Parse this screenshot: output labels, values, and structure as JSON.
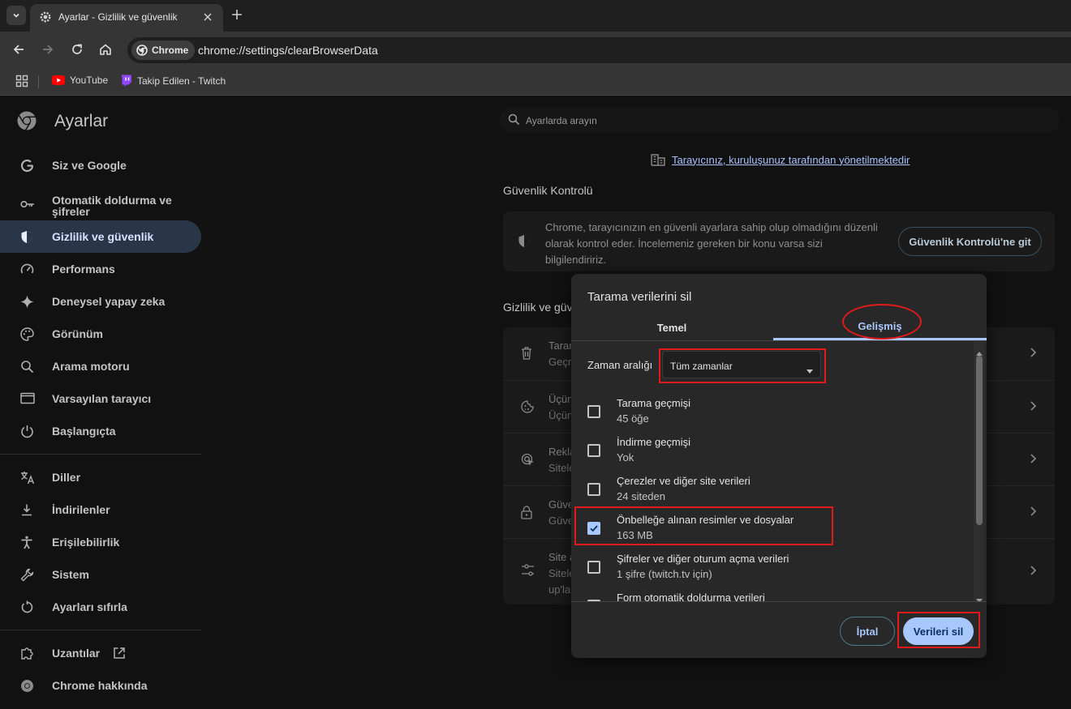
{
  "browser": {
    "tab": {
      "title": "Ayarlar - Gizlilik ve güvenlik",
      "icon": "gear-icon"
    },
    "omnibox": {
      "chip_label": "Chrome",
      "url": "chrome://settings/clearBrowserData"
    },
    "bookmarks": [
      {
        "label": "YouTube",
        "icon": "youtube-icon"
      },
      {
        "label": "Takip Edilen - Twitch",
        "icon": "twitch-icon"
      }
    ]
  },
  "settings": {
    "title": "Ayarlar",
    "search_placeholder": "Ayarlarda arayın",
    "managed_notice": "Tarayıcınız, kuruluşunuz tarafından yönetilmektedir",
    "sidebar": {
      "items": [
        {
          "label": "Siz ve Google",
          "icon": "google-icon"
        },
        {
          "label": "Otomatik doldurma ve\nşifreler",
          "icon": "key-icon"
        },
        {
          "label": "Gizlilik ve güvenlik",
          "icon": "shield-icon",
          "active": true
        },
        {
          "label": "Performans",
          "icon": "speedometer-icon"
        },
        {
          "label": "Deneysel yapay zeka",
          "icon": "sparkle-icon"
        },
        {
          "label": "Görünüm",
          "icon": "palette-icon"
        },
        {
          "label": "Arama motoru",
          "icon": "search-icon"
        },
        {
          "label": "Varsayılan tarayıcı",
          "icon": "browser-window-icon"
        },
        {
          "label": "Başlangıçta",
          "icon": "power-icon"
        },
        {
          "label": "Diller",
          "icon": "translate-icon"
        },
        {
          "label": "İndirilenler",
          "icon": "download-icon"
        },
        {
          "label": "Erişilebilirlik",
          "icon": "accessibility-icon"
        },
        {
          "label": "Sistem",
          "icon": "wrench-icon"
        },
        {
          "label": "Ayarları sıfırla",
          "icon": "reset-icon"
        },
        {
          "label": "Uzantılar",
          "icon": "puzzle-icon"
        },
        {
          "label": "Chrome hakkında",
          "icon": "chrome-icon"
        }
      ]
    },
    "safety_check": {
      "heading": "Güvenlik Kontrolü",
      "text": "Chrome, tarayıcınızın en güvenli ayarlara sahip olup olmadığını düzenli olarak kontrol eder. İncelemeniz gereken bir konu varsa sizi bilgilendiririz.",
      "button": "Güvenlik Kontrolü'ne git"
    },
    "privacy": {
      "heading": "Gizlilik ve güv",
      "rows": [
        {
          "t1": "Taran",
          "t2": "Geçn",
          "icon": "trash-icon"
        },
        {
          "t1": "Üçün",
          "t2": "Üçün",
          "icon": "cookie-icon"
        },
        {
          "t1": "Rekla",
          "t2": "Sitele",
          "icon": "ad-privacy-icon"
        },
        {
          "t1": "Güve",
          "t2": "Güve",
          "icon": "lock-icon"
        },
        {
          "t1": "Site a",
          "t2": "Sitele",
          "t3": "up'la",
          "icon": "tune-icon"
        }
      ]
    }
  },
  "dialog": {
    "title": "Tarama verilerini sil",
    "tabs": [
      "Temel",
      "Gelişmiş"
    ],
    "active_tab": "Gelişmiş",
    "time_range_label": "Zaman aralığı",
    "time_range_value": "Tüm zamanlar",
    "items": [
      {
        "name": "Tarama geçmişi",
        "sub": "45 öğe",
        "checked": false
      },
      {
        "name": "İndirme geçmişi",
        "sub": "Yok",
        "checked": false
      },
      {
        "name": "Çerezler ve diğer site verileri",
        "sub": "24 siteden",
        "checked": false
      },
      {
        "name": "Önbelleğe alınan resimler ve dosyalar",
        "sub": "163 MB",
        "checked": true
      },
      {
        "name": "Şifreler ve diğer oturum açma verileri",
        "sub": "1 şifre (twitch.tv için)",
        "checked": false
      },
      {
        "name": "Form otomatik doldurma verileri",
        "sub": "",
        "checked": false
      }
    ],
    "cancel_label": "İptal",
    "delete_label": "Verileri sil"
  },
  "colors": {
    "accent": "#a8c7fa",
    "highlight": "#e01a1a",
    "dialog_bg": "#282828",
    "page_bg": "#111111"
  }
}
